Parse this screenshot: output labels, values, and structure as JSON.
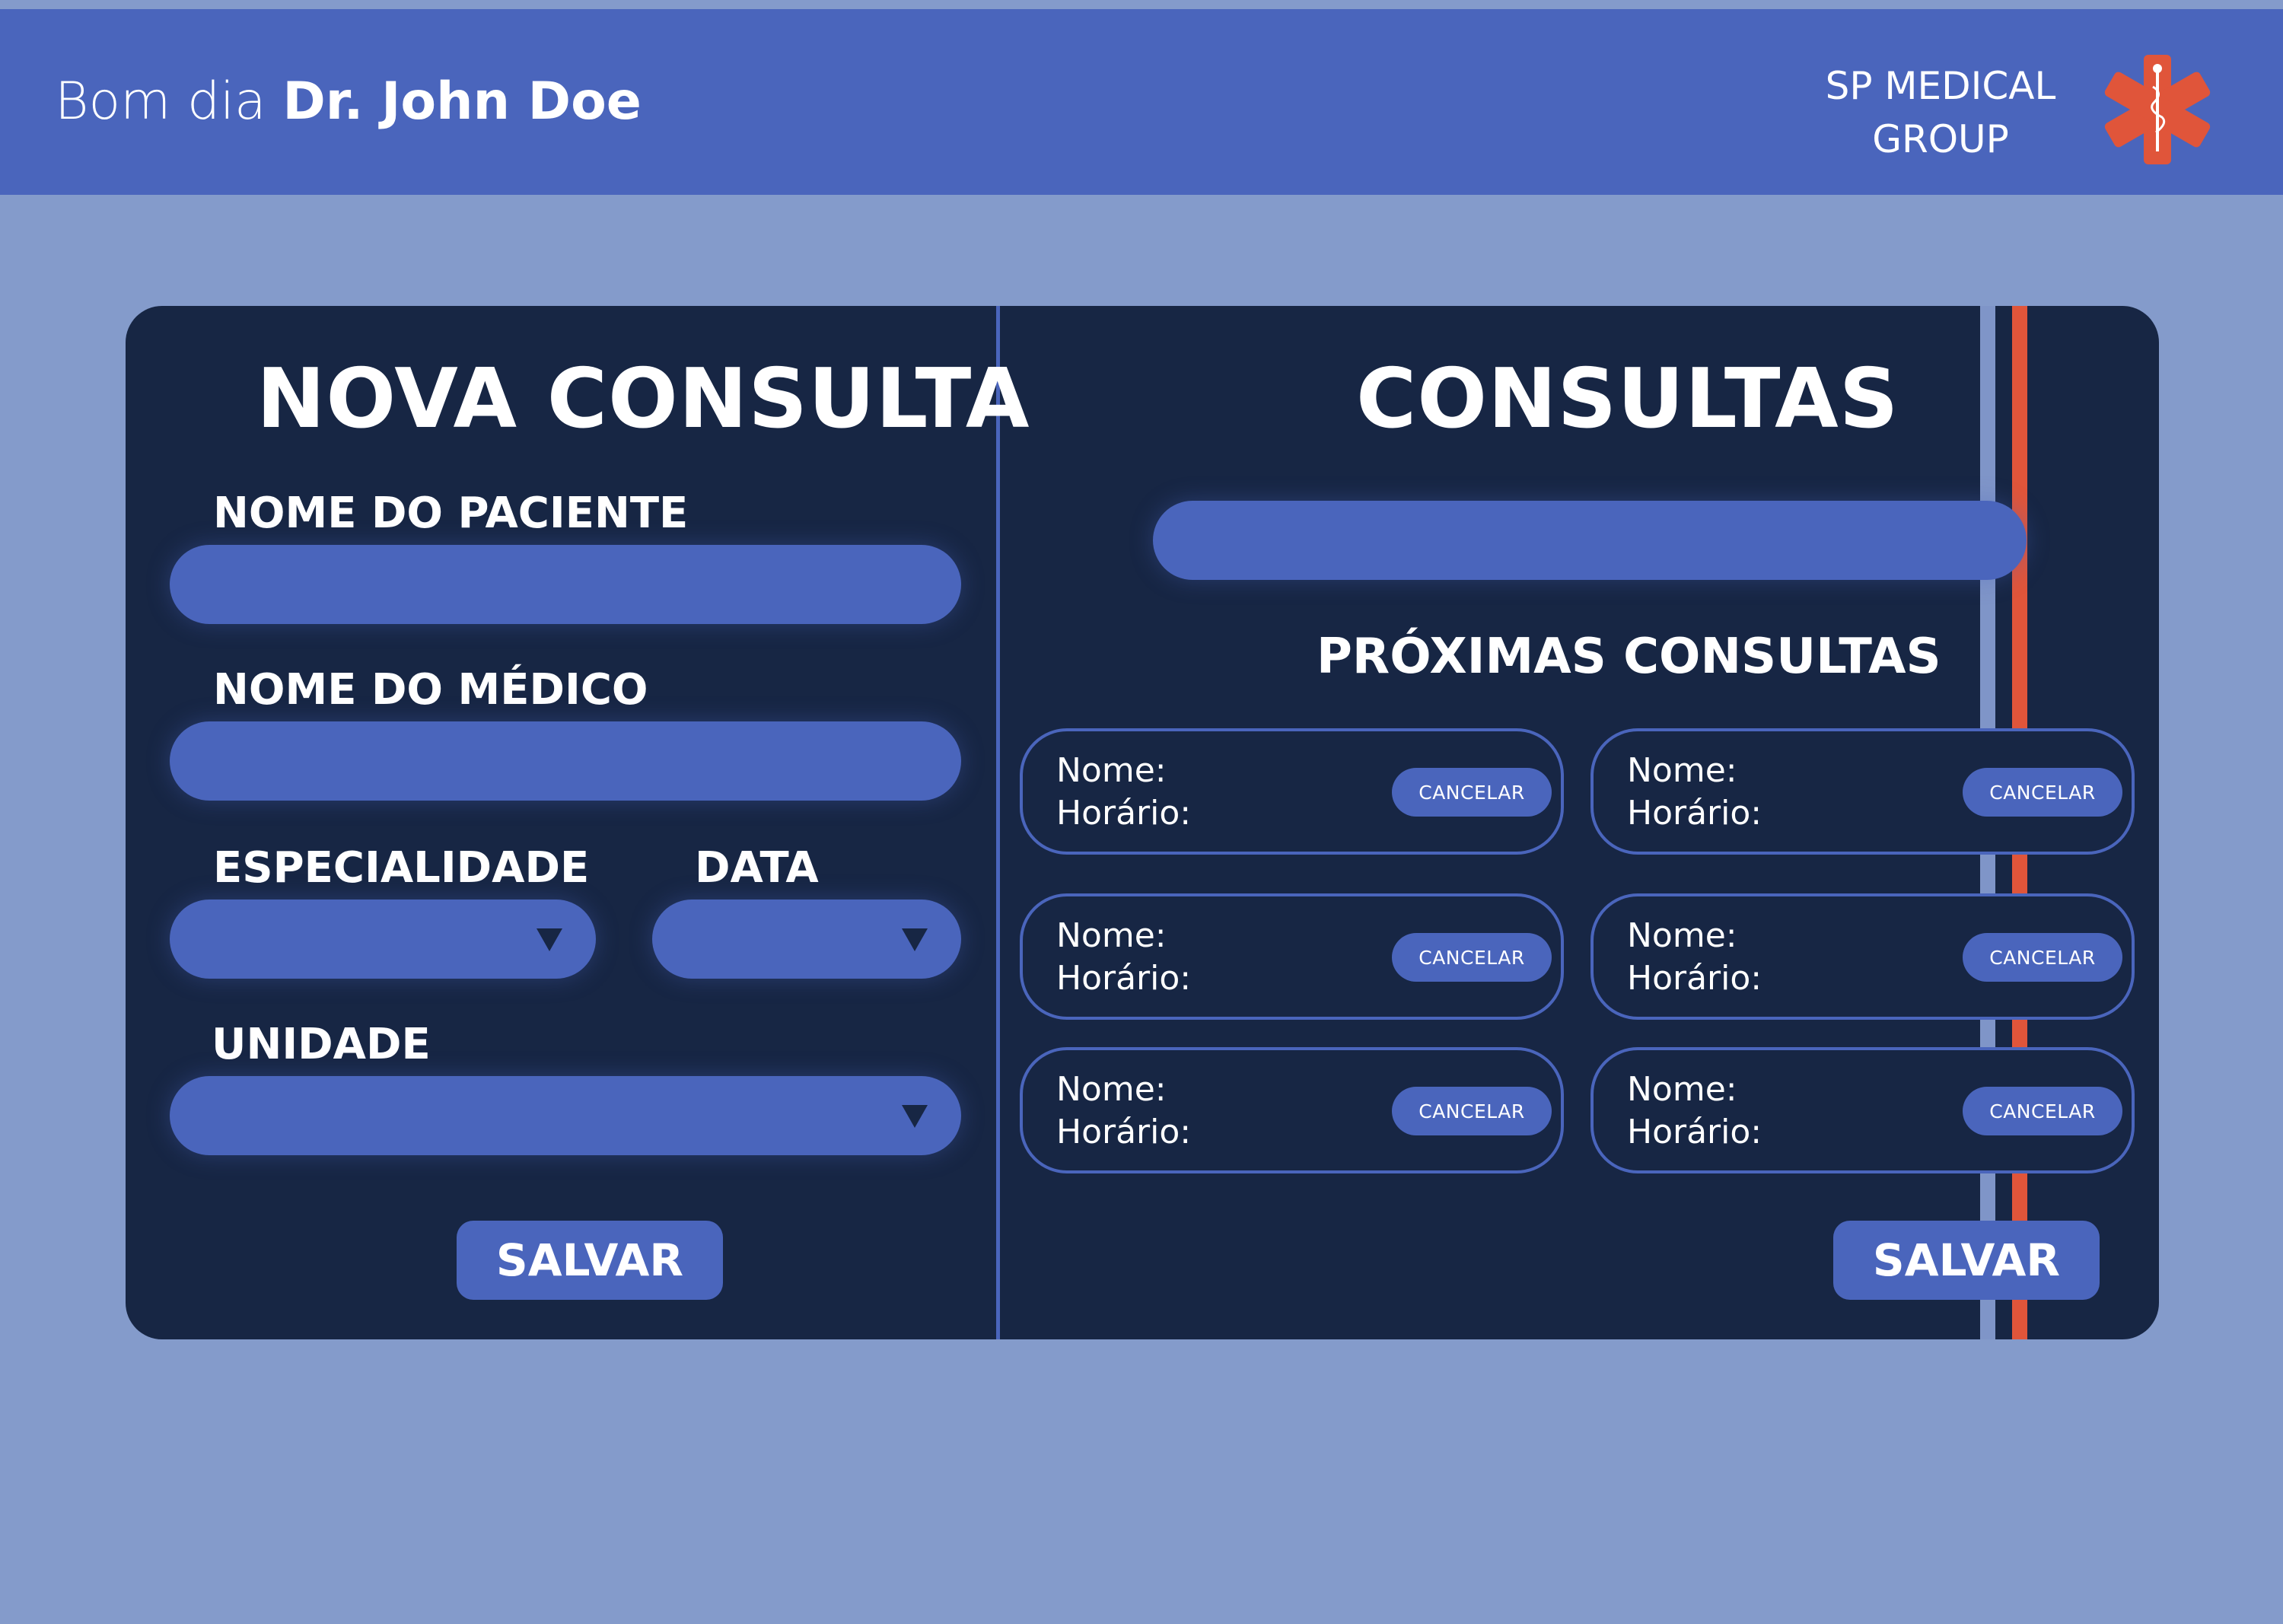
{
  "header": {
    "greeting_prefix": "Bom dia",
    "doctor_name": "Dr. John Doe",
    "brand_line1": "SP MEDICAL",
    "brand_line2": "GROUP",
    "logo_icon": "star-of-life-icon"
  },
  "colors": {
    "background": "#849bcb",
    "header": "#4a65bc",
    "card": "#172644",
    "accent": "#4a65bc",
    "logo": "#e0553a"
  },
  "new_appointment": {
    "title": "NOVA CONSULTA",
    "patient_label": "NOME DO PACIENTE",
    "patient_value": "",
    "doctor_label": "NOME DO MÉDICO",
    "doctor_value": "",
    "specialty_label": "ESPECIALIDADE",
    "specialty_value": "",
    "date_label": "DATA",
    "date_value": "",
    "unit_label": "UNIDADE",
    "unit_value": "",
    "save_label": "SALVAR"
  },
  "appointments": {
    "title": "CONSULTAS",
    "search_value": "",
    "upcoming_title": "PRÓXIMAS CONSULTAS",
    "items": [
      {
        "name_label": "Nome:",
        "time_label": "Horário:",
        "cancel_label": "CANCELAR"
      },
      {
        "name_label": "Nome:",
        "time_label": "Horário:",
        "cancel_label": "CANCELAR"
      },
      {
        "name_label": "Nome:",
        "time_label": "Horário:",
        "cancel_label": "CANCELAR"
      },
      {
        "name_label": "Nome:",
        "time_label": "Horário:",
        "cancel_label": "CANCELAR"
      },
      {
        "name_label": "Nome:",
        "time_label": "Horário:",
        "cancel_label": "CANCELAR"
      },
      {
        "name_label": "Nome:",
        "time_label": "Horário:",
        "cancel_label": "CANCELAR"
      }
    ],
    "save_label": "SALVAR"
  }
}
